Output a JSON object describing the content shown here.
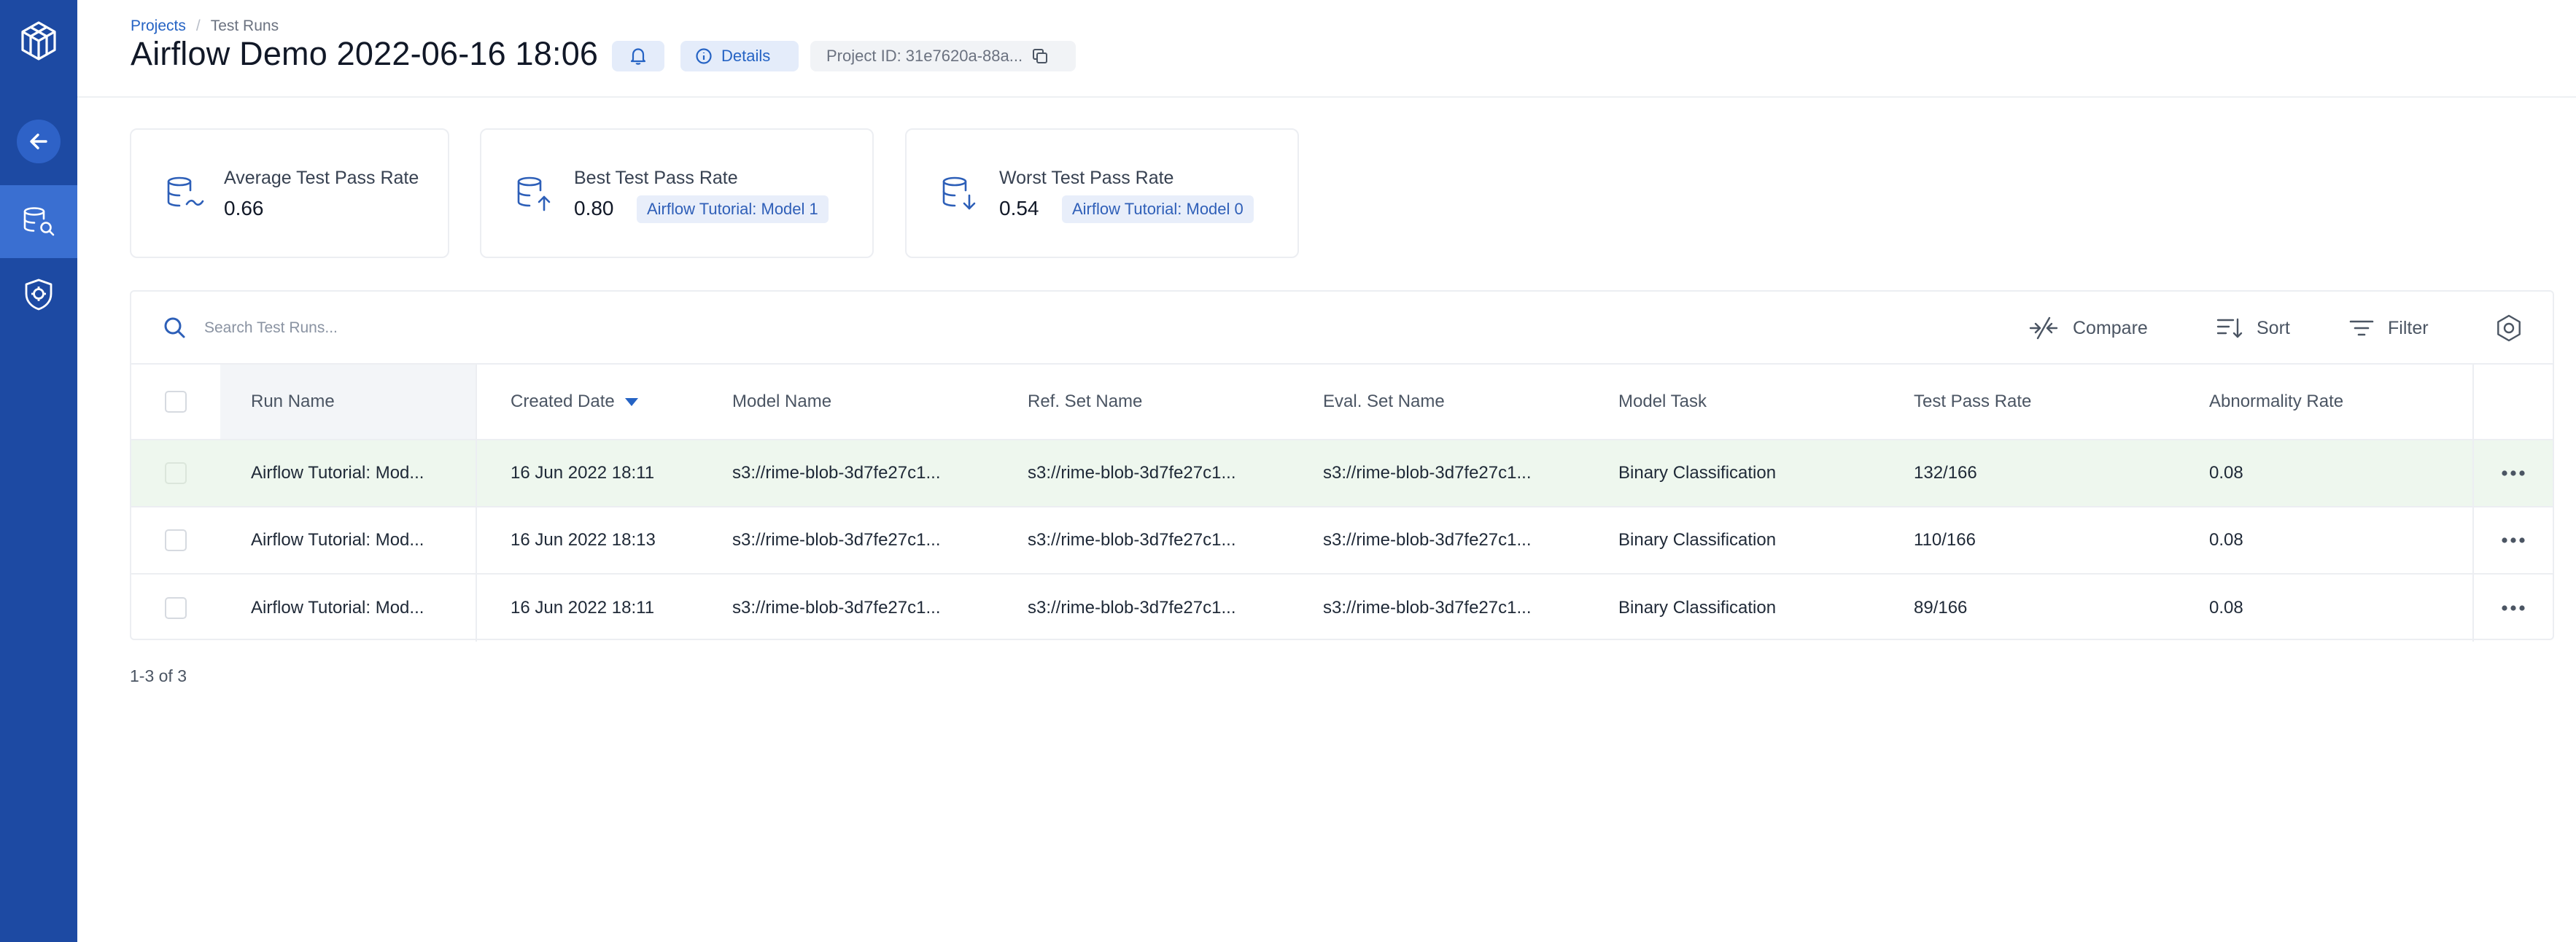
{
  "breadcrumb": {
    "projects": "Projects",
    "separator": "/",
    "current": "Test Runs"
  },
  "header": {
    "title": "Airflow Demo 2022-06-16 18:06",
    "details_label": "Details",
    "project_id_label": "Project ID: 31e7620a-88a..."
  },
  "stats": [
    {
      "label": "Average Test Pass Rate",
      "value": "0.66",
      "icon": "database-average-icon"
    },
    {
      "label": "Best Test Pass Rate",
      "value": "0.80",
      "tag": "Airflow Tutorial: Model 1",
      "icon": "database-up-icon"
    },
    {
      "label": "Worst Test Pass Rate",
      "value": "0.54",
      "tag": "Airflow Tutorial: Model 0",
      "icon": "database-down-icon"
    }
  ],
  "toolbar": {
    "search_placeholder": "Search Test Runs...",
    "compare_label": "Compare",
    "sort_label": "Sort",
    "filter_label": "Filter"
  },
  "table": {
    "columns": [
      "Run Name",
      "Created Date",
      "Model Name",
      "Ref. Set Name",
      "Eval. Set Name",
      "Model Task",
      "Test Pass Rate",
      "Abnormality Rate"
    ],
    "rows": [
      {
        "run_name": "Airflow Tutorial: Mod...",
        "created": "16 Jun 2022 18:11",
        "model": "s3://rime-blob-3d7fe27c1...",
        "ref": "s3://rime-blob-3d7fe27c1...",
        "eval": "s3://rime-blob-3d7fe27c1...",
        "task": "Binary Classification",
        "pass": "132/166",
        "abn": "0.08"
      },
      {
        "run_name": "Airflow Tutorial: Mod...",
        "created": "16 Jun 2022 18:13",
        "model": "s3://rime-blob-3d7fe27c1...",
        "ref": "s3://rime-blob-3d7fe27c1...",
        "eval": "s3://rime-blob-3d7fe27c1...",
        "task": "Binary Classification",
        "pass": "110/166",
        "abn": "0.08"
      },
      {
        "run_name": "Airflow Tutorial: Mod...",
        "created": "16 Jun 2022 18:11",
        "model": "s3://rime-blob-3d7fe27c1...",
        "ref": "s3://rime-blob-3d7fe27c1...",
        "eval": "s3://rime-blob-3d7fe27c1...",
        "task": "Binary Classification",
        "pass": "89/166",
        "abn": "0.08"
      }
    ]
  },
  "pagination": {
    "label": "1-3 of 3"
  },
  "colors": {
    "sidebar": "#1d4aa3",
    "accent": "#2563c4",
    "highlight_row": "#eef7ee"
  }
}
